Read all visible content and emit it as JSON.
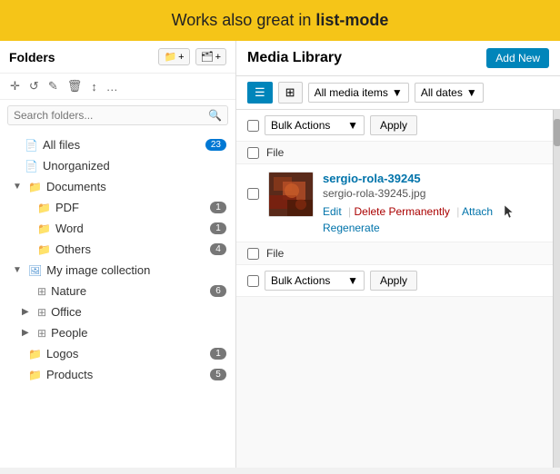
{
  "banner": {
    "text_prefix": "Works also great in ",
    "text_bold": "list-mode"
  },
  "sidebar": {
    "title": "Folders",
    "btn_new_folder": "📁+",
    "btn_new_item": "🗂+",
    "toolbar_icons": [
      "✛",
      "↺",
      "✎",
      "🗑",
      "↕",
      "…"
    ],
    "search_placeholder": "Search folders...",
    "items": [
      {
        "id": "all-files",
        "label": "All files",
        "badge": "23",
        "indent": 0,
        "icon": "📄"
      },
      {
        "id": "unorganized",
        "label": "Unorganized",
        "badge": "",
        "indent": 0,
        "icon": "📄"
      },
      {
        "id": "documents",
        "label": "Documents",
        "badge": "",
        "indent": 1,
        "icon": "📁",
        "expand": "▼"
      },
      {
        "id": "pdf",
        "label": "PDF",
        "badge": "1",
        "indent": 2,
        "icon": "📁"
      },
      {
        "id": "word",
        "label": "Word",
        "badge": "1",
        "indent": 2,
        "icon": "📁"
      },
      {
        "id": "others",
        "label": "Others",
        "badge": "4",
        "indent": 2,
        "icon": "📁"
      },
      {
        "id": "my-image-collection",
        "label": "My image collection",
        "badge": "",
        "indent": 1,
        "icon": "🖼",
        "expand": "▼"
      },
      {
        "id": "nature",
        "label": "Nature",
        "badge": "6",
        "indent": 2,
        "icon": "⊞"
      },
      {
        "id": "office",
        "label": "Office",
        "badge": "",
        "indent": 2,
        "icon": "⊞",
        "expand": "▶"
      },
      {
        "id": "people",
        "label": "People",
        "badge": "",
        "indent": 2,
        "icon": "⊞",
        "expand": "▶"
      },
      {
        "id": "logos",
        "label": "Logos",
        "badge": "1",
        "indent": 1,
        "icon": "📁"
      },
      {
        "id": "products",
        "label": "Products",
        "badge": "5",
        "indent": 1,
        "icon": "📁"
      }
    ]
  },
  "media_library": {
    "title": "Media Library",
    "add_new_label": "Add New",
    "filter_all_media": "All media items",
    "filter_all_dates": "All dates",
    "bulk_actions_label": "Bulk Actions",
    "apply_label": "Apply",
    "file_col_label": "File",
    "files": [
      {
        "id": "file-1",
        "name": "sergio-rola-39245",
        "meta": "sergio-rola-39245.jpg",
        "actions": [
          "Edit",
          "Delete Permanently",
          "Attach"
        ]
      }
    ]
  }
}
